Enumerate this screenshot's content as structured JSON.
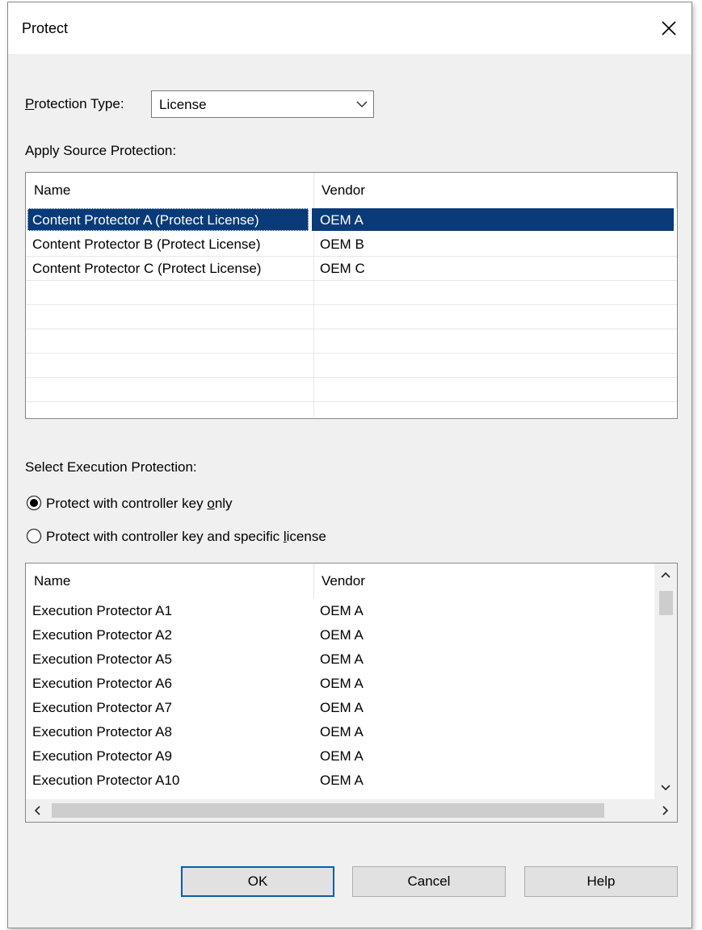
{
  "window": {
    "title": "Protect"
  },
  "protection_type": {
    "label_first": "P",
    "label_rest": "rotection Type:",
    "value": "License"
  },
  "source": {
    "label": "Apply Source Protection:",
    "columns": [
      "Name",
      "Vendor"
    ],
    "rows": [
      {
        "name": "Content Protector A (Protect License)",
        "vendor": "OEM A",
        "selected": true
      },
      {
        "name": "Content Protector B (Protect License)",
        "vendor": "OEM B"
      },
      {
        "name": "Content Protector C (Protect License)",
        "vendor": "OEM C"
      }
    ]
  },
  "execution": {
    "label": "Select Execution Protection:",
    "options": [
      {
        "pre": "Protect with controller key ",
        "ul": "o",
        "post": "nly",
        "checked": true
      },
      {
        "pre": "Protect with controller key and specific ",
        "ul": "l",
        "post": "icense",
        "checked": false
      }
    ],
    "columns": [
      "Name",
      "Vendor"
    ],
    "rows": [
      {
        "name": "Execution Protector A1",
        "vendor": "OEM A"
      },
      {
        "name": "Execution Protector A2",
        "vendor": "OEM A"
      },
      {
        "name": "Execution Protector A5",
        "vendor": "OEM A"
      },
      {
        "name": "Execution Protector A6",
        "vendor": "OEM A"
      },
      {
        "name": "Execution Protector A7",
        "vendor": "OEM A"
      },
      {
        "name": "Execution Protector A8",
        "vendor": "OEM A"
      },
      {
        "name": "Execution Protector A9",
        "vendor": "OEM A"
      },
      {
        "name": "Execution Protector A10",
        "vendor": "OEM A"
      }
    ]
  },
  "buttons": {
    "ok": "OK",
    "cancel": "Cancel",
    "help": "Help"
  },
  "colors": {
    "selection": "#0a3a78",
    "dialog_bg": "#f0f0f0",
    "default_button_border": "#0a5cad"
  },
  "icons": {
    "close": "close-icon",
    "dropdown": "chevron-down-icon"
  }
}
